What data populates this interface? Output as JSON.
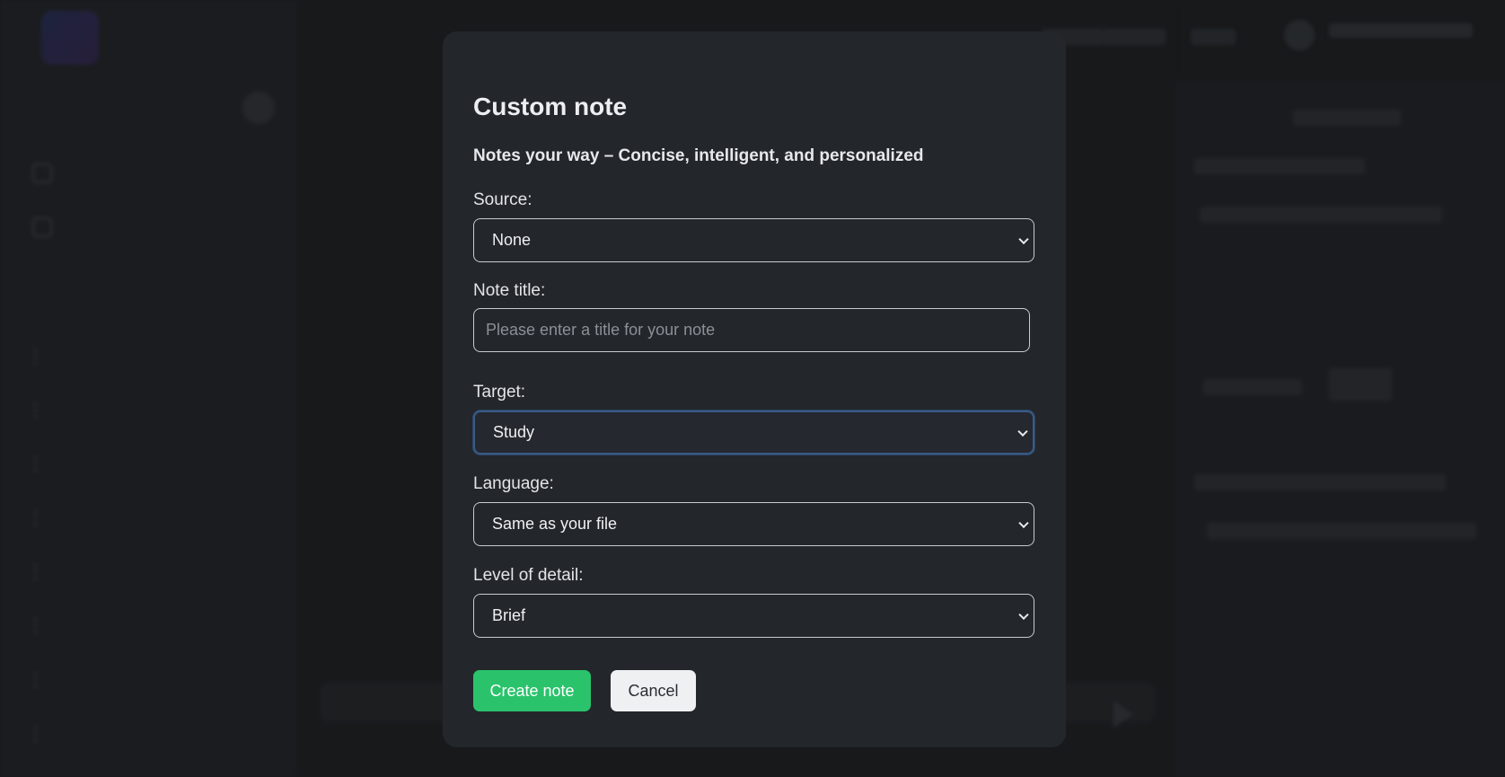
{
  "modal": {
    "title": "Custom note",
    "subtitle": "Notes your way – Concise, intelligent, and personalized",
    "source": {
      "label": "Source:",
      "value": "None"
    },
    "note_title": {
      "label": "Note title:",
      "placeholder": "Please enter a title for your note",
      "value": ""
    },
    "target": {
      "label": "Target:",
      "value": "Study"
    },
    "language": {
      "label": "Language:",
      "value": "Same as your file"
    },
    "detail": {
      "label": "Level of detail:",
      "value": "Brief"
    },
    "create_label": "Create note",
    "cancel_label": "Cancel"
  },
  "colors": {
    "primary_button": "#2ac36c",
    "modal_background": "#23262b",
    "focus_ring": "#3a5a86"
  },
  "icons": [
    "chevron-down-icon"
  ]
}
